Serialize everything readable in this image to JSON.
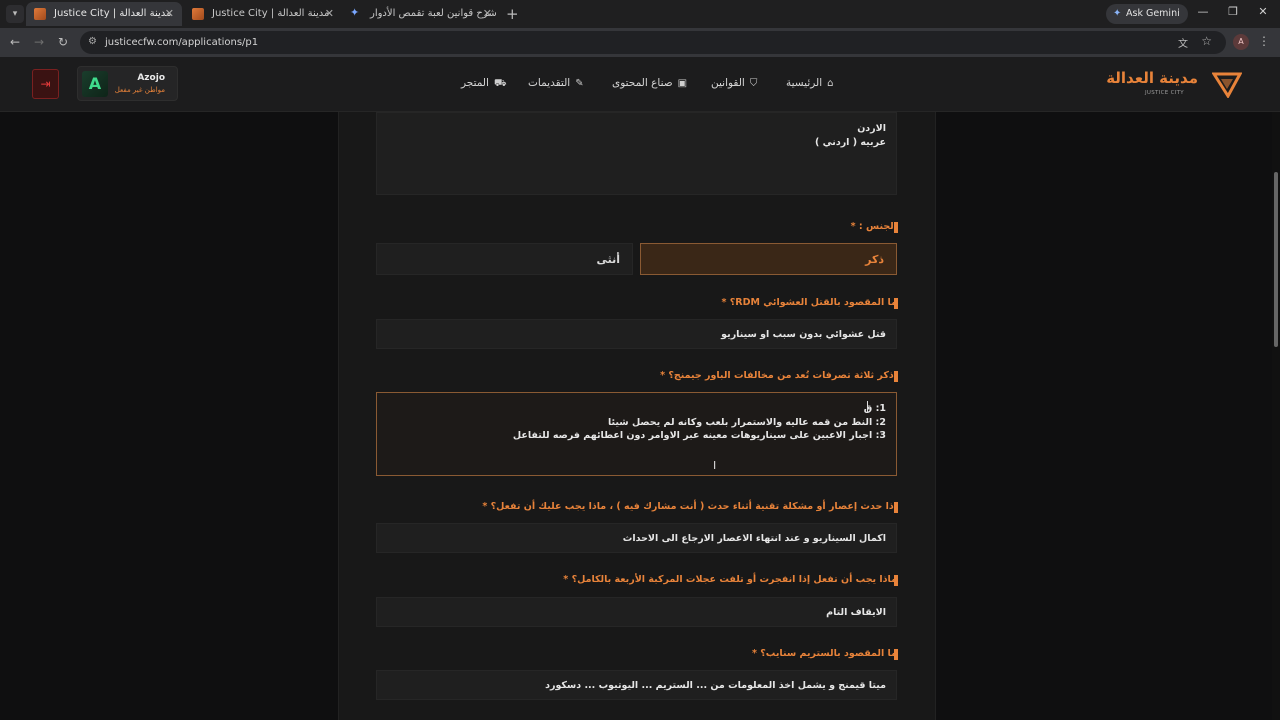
{
  "browser": {
    "tabs": [
      {
        "title": "Justice City | مدينة العدالة",
        "active": true
      },
      {
        "title": "Justice City | مدينة العدالة",
        "active": false
      },
      {
        "title": "شرح قوانين لعبة تقمص الأدوار -",
        "active": false
      }
    ],
    "ask_gemini": "Ask Gemini",
    "url": "justicecfw.com/applications/p1",
    "profile_initial": "A"
  },
  "site": {
    "brand_name": "مدينة العدالة",
    "brand_sub": "JUSTICE CITY",
    "nav": [
      {
        "label": "الرئيسية",
        "icon": "home-icon"
      },
      {
        "label": "القوانين",
        "icon": "shield-icon"
      },
      {
        "label": "صناع المحتوى",
        "icon": "video-icon"
      },
      {
        "label": "التقديمات",
        "icon": "edit-icon"
      },
      {
        "label": "المتجر",
        "icon": "cart-icon"
      }
    ],
    "user": {
      "name": "Azojo",
      "role": "مواطن غير مفعل",
      "avatar_letter": "A"
    },
    "accent": "#e8833a"
  },
  "form": {
    "nationality_answer": "الاردن\nعربيه ( اردني )",
    "gender": {
      "label": "الجنس :",
      "required": "*",
      "male": "ذكر",
      "female": "أنثى",
      "selected": "male"
    },
    "questions": [
      {
        "label": "ما المقصود بالقتل العشوائي RDM؟",
        "required": "*",
        "answer": "قتل عشوائي بدون سبب او سيناريو"
      },
      {
        "label": "اذكر ثلاثة تصرفات تُعد من مخالفات الباور جيمنج؟",
        "required": "*",
        "answer": "1: ق\n2: النط من قمه عاليه والاستمرار بلعب وكانه لم يحصل شيئا\n3: اجبار الاعبين على سيناريوهات معينه عبر الاوامر دون اعطائهم فرصه للتفاعل"
      },
      {
        "label": "إذا حدث إعصار أو مشكلة تقنية أثناء حدث ( أنت مشارك فيه ) ، ماذا يجب عليك أن تفعل؟",
        "required": "*",
        "answer": "اكمال السيناريو و عند انتهاء الاعصار الارجاع الى الاحداث"
      },
      {
        "label": "ماذا يجب أن تفعل إذا انفجرت أو تلفت عجلات المركبة الأربعة بالكامل؟",
        "required": "*",
        "answer": "الايقاف التام"
      },
      {
        "label": "ما المقصود بالستريم سنايب؟",
        "required": "*",
        "answer": "ميتا قيمنج و يشمل اخذ المعلومات من ... الستريم ... اليوتيوب ... دسكورد"
      }
    ]
  }
}
